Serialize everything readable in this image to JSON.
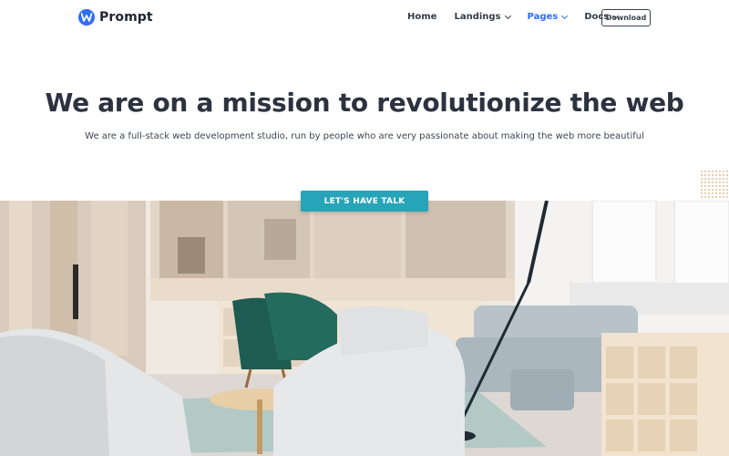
{
  "brand": {
    "name": "Prompt",
    "logo_icon": "w-logo-icon",
    "accent": "#2f6df6"
  },
  "nav": {
    "items": [
      {
        "label": "Home",
        "has_dropdown": false,
        "active": false
      },
      {
        "label": "Landings",
        "has_dropdown": true,
        "active": false
      },
      {
        "label": "Pages",
        "has_dropdown": true,
        "active": true
      },
      {
        "label": "Docs",
        "has_dropdown": true,
        "active": false
      }
    ],
    "download_label": "Download"
  },
  "hero": {
    "title_before": "We are on a mission to",
    "title_highlight": "revolutionize",
    "title_after": "the web",
    "subtitle": "We are a full-stack web development studio, run by people who are very passionate about making the web more beautiful",
    "cta_label": "LET'S HAVE TALK",
    "cta_color": "#27a4b8",
    "highlight_color": "#7dd8e5"
  },
  "image": {
    "description": "office-lounge-photo"
  }
}
